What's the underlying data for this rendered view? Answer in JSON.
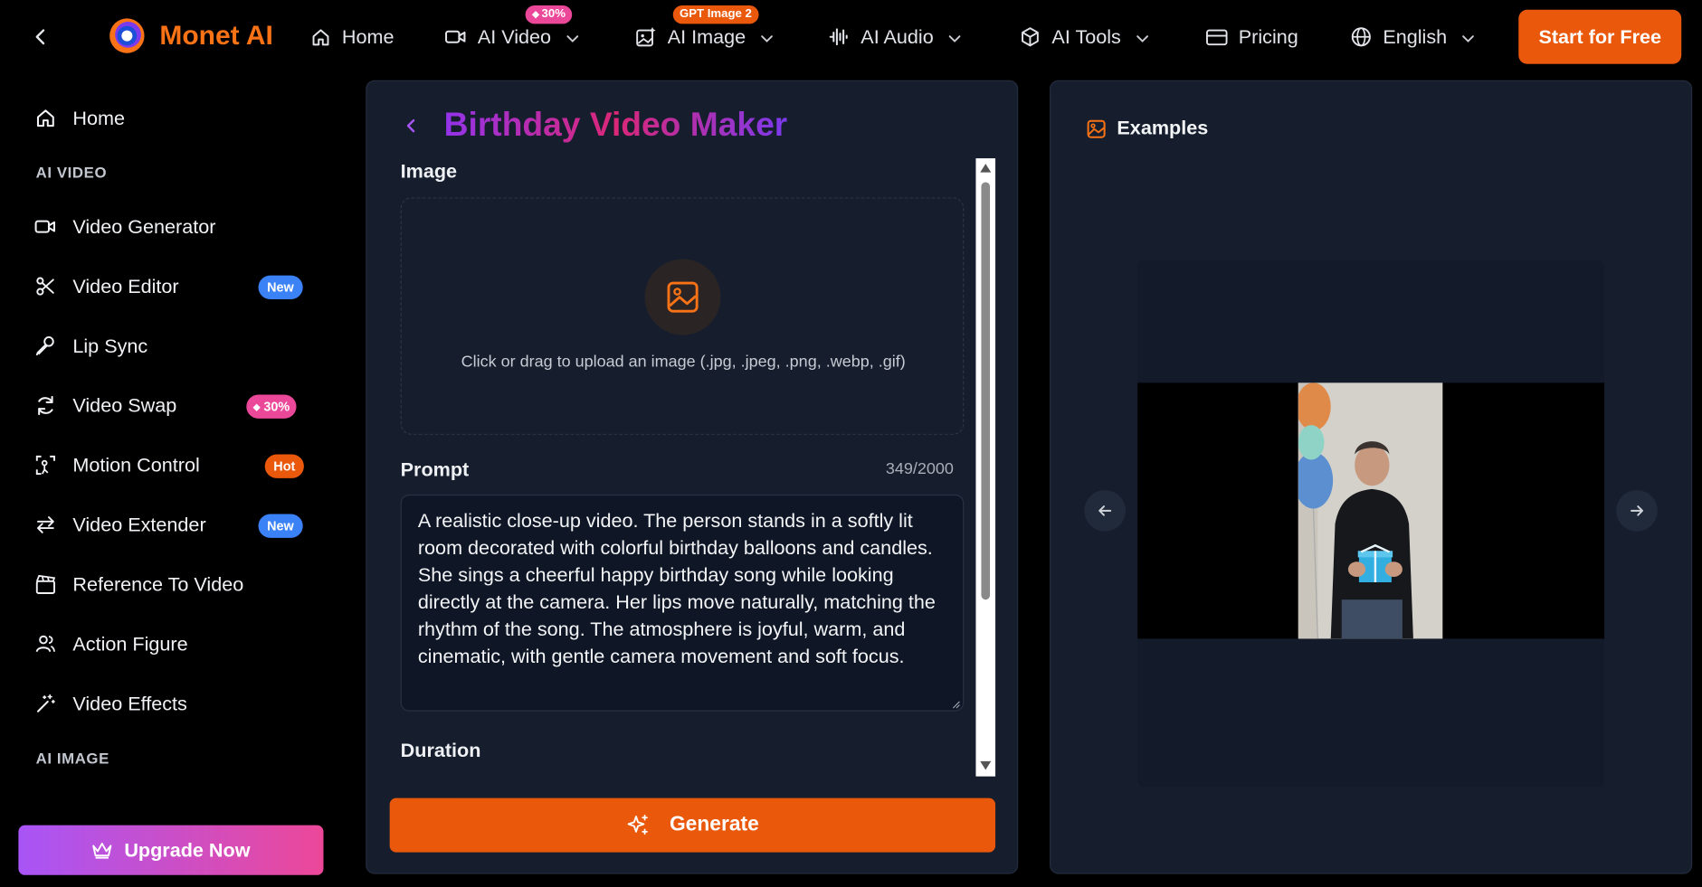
{
  "header": {
    "back_icon": "chevron-left-icon",
    "brand": "Monet AI",
    "nav": [
      {
        "label": "Home",
        "icon": "home-icon"
      },
      {
        "label": "AI Video",
        "icon": "video-camera-icon",
        "badge": "30%"
      },
      {
        "label": "AI Image",
        "icon": "image-sparkle-icon",
        "badge": "GPT Image 2"
      },
      {
        "label": "AI Audio",
        "icon": "audio-wave-icon"
      },
      {
        "label": "AI Tools",
        "icon": "cube-icon"
      },
      {
        "label": "Pricing",
        "icon": "credit-card-icon"
      },
      {
        "label": "English",
        "icon": "globe-icon"
      }
    ],
    "cta": "Start for Free",
    "accent": "#ea580c"
  },
  "sidebar": {
    "home": "Home",
    "section_video": "AI VIDEO",
    "items": [
      {
        "label": "Video Generator",
        "icon": "video-camera-icon"
      },
      {
        "label": "Video Editor",
        "icon": "scissors-icon",
        "badge": "New"
      },
      {
        "label": "Lip Sync",
        "icon": "microphone-icon"
      },
      {
        "label": "Video Swap",
        "icon": "refresh-icon",
        "badge": "30%"
      },
      {
        "label": "Motion Control",
        "icon": "motion-icon",
        "badge": "Hot"
      },
      {
        "label": "Video Extender",
        "icon": "arrows-horizontal-icon",
        "badge": "New"
      },
      {
        "label": "Reference To Video",
        "icon": "clapperboard-icon"
      },
      {
        "label": "Action Figure",
        "icon": "users-icon"
      },
      {
        "label": "Video Effects",
        "icon": "magic-wand-icon"
      }
    ],
    "section_image": "AI IMAGE",
    "upgrade": "Upgrade Now"
  },
  "form": {
    "title": "Birthday Video Maker",
    "image_label": "Image",
    "upload_text": "Click or drag to upload an image (.jpg, .jpeg, .png, .webp, .gif)",
    "prompt_label": "Prompt",
    "prompt_count": "349/2000",
    "prompt_value": "A realistic close-up video. The person stands in a softly lit room decorated with colorful birthday balloons and candles. She sings a cheerful happy birthday song while looking directly at the camera. Her lips move naturally, matching the rhythm of the song. The atmosphere is joyful, warm, and cinematic, with gentle camera movement and soft focus.",
    "duration_label": "Duration",
    "generate": "Generate"
  },
  "examples": {
    "title": "Examples",
    "icon": "image-icon"
  }
}
